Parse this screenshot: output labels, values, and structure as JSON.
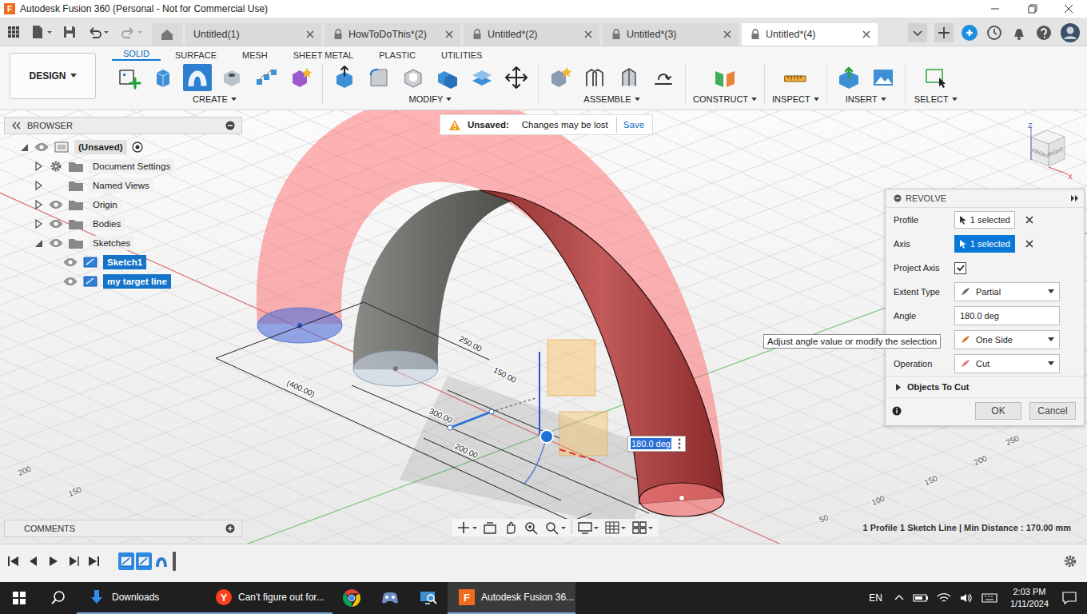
{
  "window": {
    "title": "Autodesk Fusion 360 (Personal - Not for Commercial Use)",
    "logo": "F"
  },
  "quick_access": {
    "redo_disabled": true
  },
  "document_tabs": [
    {
      "label": "Untitled(1)",
      "locked": false,
      "selected": false
    },
    {
      "label": "HowToDoThis*(2)",
      "locked": true,
      "selected": false
    },
    {
      "label": "Untitled*(2)",
      "locked": true,
      "selected": false
    },
    {
      "label": "Untitled*(3)",
      "locked": true,
      "selected": false
    },
    {
      "label": "Untitled*(4)",
      "locked": true,
      "selected": true
    }
  ],
  "workspace": {
    "label": "DESIGN"
  },
  "toolbar_tabs": [
    {
      "label": "SOLID",
      "selected": true
    },
    {
      "label": "SURFACE",
      "selected": false
    },
    {
      "label": "MESH",
      "selected": false
    },
    {
      "label": "SHEET METAL",
      "selected": false
    },
    {
      "label": "PLASTIC",
      "selected": false
    },
    {
      "label": "UTILITIES",
      "selected": false
    }
  ],
  "tool_groups": [
    {
      "label": "CREATE",
      "tools": [
        {
          "selected": false
        },
        {
          "selected": false
        },
        {
          "selected": true
        },
        {
          "selected": false
        },
        {
          "selected": false
        },
        {
          "selected": false
        }
      ]
    },
    {
      "label": "MODIFY",
      "tools": [
        {
          "selected": false
        },
        {
          "selected": false
        },
        {
          "selected": false
        },
        {
          "selected": false
        },
        {
          "selected": false
        },
        {
          "selected": false
        }
      ]
    },
    {
      "label": "ASSEMBLE",
      "tools": [
        {
          "selected": false
        },
        {
          "selected": false
        },
        {
          "selected": false
        },
        {
          "selected": false
        }
      ]
    },
    {
      "label": "CONSTRUCT",
      "tools": [
        {
          "selected": false
        }
      ]
    },
    {
      "label": "INSPECT",
      "tools": [
        {
          "selected": false
        }
      ]
    },
    {
      "label": "INSERT",
      "tools": [
        {
          "selected": false
        },
        {
          "selected": false
        }
      ]
    },
    {
      "label": "SELECT",
      "tools": [
        {
          "selected": false
        }
      ]
    }
  ],
  "browser": {
    "title": "BROWSER",
    "root": {
      "label": "(Unsaved)",
      "expanded": true,
      "visible": true
    },
    "items": [
      {
        "label": "Document Settings",
        "kind": "settings",
        "depth": 1,
        "expanded": false,
        "selected": false
      },
      {
        "label": "Named Views",
        "kind": "views",
        "depth": 1,
        "expanded": false,
        "selected": false
      },
      {
        "label": "Origin",
        "kind": "folder",
        "depth": 1,
        "expanded": false,
        "visible": true,
        "selected": false
      },
      {
        "label": "Bodies",
        "kind": "folder",
        "depth": 1,
        "expanded": false,
        "visible": true,
        "selected": false
      },
      {
        "label": "Sketches",
        "kind": "folder",
        "depth": 1,
        "expanded": true,
        "visible": true,
        "selected": false
      },
      {
        "label": "Sketch1",
        "kind": "sketch",
        "depth": 2,
        "visible": true,
        "selected": true
      },
      {
        "label": "my target line",
        "kind": "sketch",
        "depth": 2,
        "visible": true,
        "selected": true
      }
    ]
  },
  "banner": {
    "label": "Unsaved:",
    "message": "Changes may be lost",
    "action": "Save"
  },
  "view_cube": {
    "faces": [
      "FRONT",
      "RIGHT"
    ],
    "axes": [
      "Z",
      "X"
    ]
  },
  "viewport": {
    "dimensions": [
      "250.00",
      "150.00",
      "(400.00)",
      "300.00",
      "200.00"
    ],
    "grid_ticks": [
      "250",
      "200",
      "150",
      "100",
      "50",
      "200",
      "150"
    ]
  },
  "angle_input": {
    "value": "180.0 deg"
  },
  "dialog": {
    "title": "REVOLVE",
    "rows": [
      {
        "kind": "selection",
        "label": "Profile",
        "value": "1 selected",
        "selected": false
      },
      {
        "kind": "selection",
        "label": "Axis",
        "value": "1 selected",
        "selected": true
      },
      {
        "kind": "checkbox",
        "label": "Project Axis",
        "checked": true
      },
      {
        "kind": "dropdown",
        "label": "Extent Type",
        "value": "Partial"
      },
      {
        "kind": "input",
        "label": "Angle",
        "value": "180.0 deg"
      },
      {
        "kind": "dropdown",
        "value": "One Side"
      },
      {
        "kind": "dropdown",
        "label": "Operation",
        "value": "Cut"
      }
    ],
    "section": {
      "label": "Objects To Cut",
      "expanded": false
    },
    "buttons": [
      "OK",
      "Cancel"
    ]
  },
  "tooltip": "Adjust angle value or modify the selection",
  "comments": {
    "title": "COMMENTS"
  },
  "status": "1 Profile 1 Sketch Line | Min Distance : 170.00 mm",
  "timeline": {
    "features": [
      {
        "kind": "sketch",
        "selected": true
      },
      {
        "kind": "sketch",
        "selected": true
      },
      {
        "kind": "revolve",
        "selected": false
      }
    ]
  },
  "taskbar": {
    "apps": [
      {
        "kind": "downloads",
        "label": "Downloads",
        "open": true,
        "selected": false
      },
      {
        "kind": "yandex",
        "label": "Can't figure out for...",
        "logo": "Y",
        "open": true,
        "selected": false
      },
      {
        "kind": "chrome",
        "open": false,
        "selected": false
      },
      {
        "kind": "game",
        "open": false,
        "selected": false
      },
      {
        "kind": "explorer",
        "open": false,
        "selected": false
      },
      {
        "kind": "fusion",
        "label": "Autodesk Fusion 36...",
        "logo": "F",
        "open": true,
        "selected": true
      }
    ],
    "tray": {
      "language": "EN",
      "time": "2:03 PM",
      "date": "1/11/2024"
    }
  }
}
